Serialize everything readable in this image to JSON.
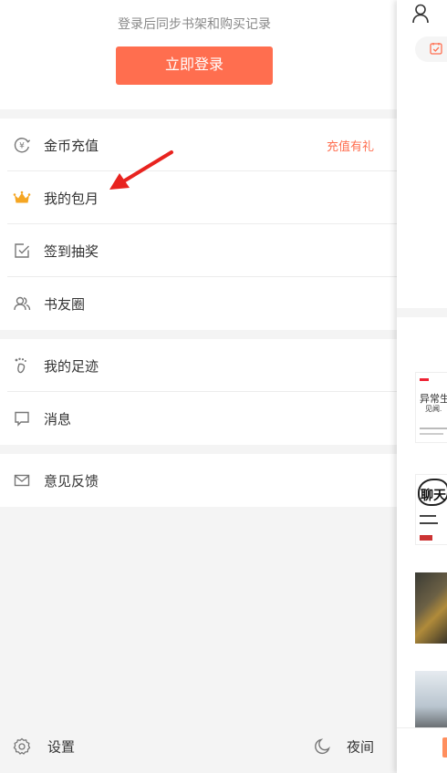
{
  "login": {
    "hint": "登录后同步书架和购买记录",
    "button": "立即登录"
  },
  "menu_group1": [
    {
      "label": "金币充值",
      "extra": "充值有礼",
      "icon": "coin-icon"
    },
    {
      "label": "我的包月",
      "icon": "crown-icon"
    },
    {
      "label": "签到抽奖",
      "icon": "checkbox-icon"
    },
    {
      "label": "书友圈",
      "icon": "friends-icon"
    }
  ],
  "menu_group2": [
    {
      "label": "我的足迹",
      "icon": "footprint-icon"
    },
    {
      "label": "消息",
      "icon": "message-icon"
    }
  ],
  "menu_group3": [
    {
      "label": "意见反馈",
      "icon": "mail-icon"
    }
  ],
  "bottom": {
    "settings": "设置",
    "night": "夜间"
  },
  "right_panel": {
    "cover1_title": "异常生",
    "cover1_sub": "见闻.",
    "cover2_title": "聊天"
  },
  "colors": {
    "accent": "#ff6e4f",
    "crown": "#f5a623",
    "arrow": "#e8231f"
  }
}
